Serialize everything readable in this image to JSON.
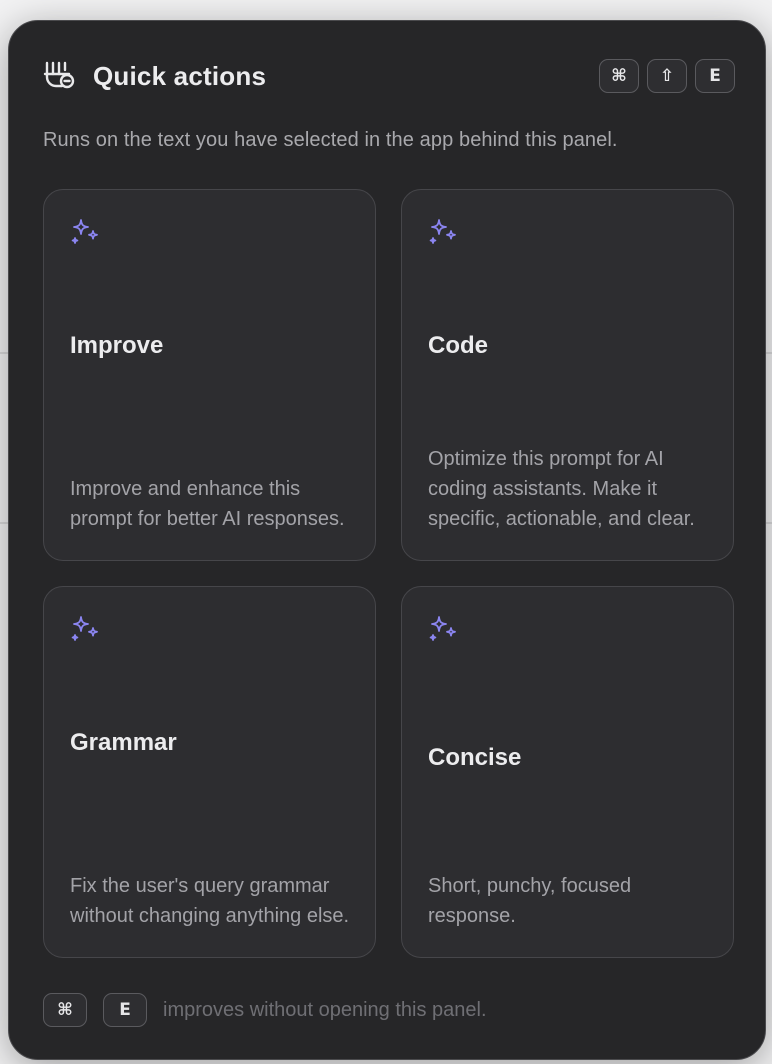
{
  "panel": {
    "title": "Quick actions",
    "shortcut_keys": [
      "⌘",
      "⇧",
      "E"
    ],
    "subtitle": "Runs on the text you have selected in the app behind this panel."
  },
  "actions": [
    {
      "title": "Improve",
      "description": "Improve and enhance this prompt for better AI responses."
    },
    {
      "title": "Code",
      "description": "Optimize this prompt for AI coding assistants. Make it specific, actionable, and clear."
    },
    {
      "title": "Grammar",
      "description": "Fix the user's query grammar without changing anything else."
    },
    {
      "title": "Concise",
      "description": "Short, punchy, focused response."
    }
  ],
  "footer": {
    "keys": [
      "⌘",
      "E"
    ],
    "text": "improves without opening this panel."
  },
  "colors": {
    "accent": "#8b85f0",
    "panel_bg": "#262628",
    "card_bg": "#2d2d30"
  },
  "icons": {
    "logo": "app-logo-icon",
    "action": "sparkle-icon"
  }
}
